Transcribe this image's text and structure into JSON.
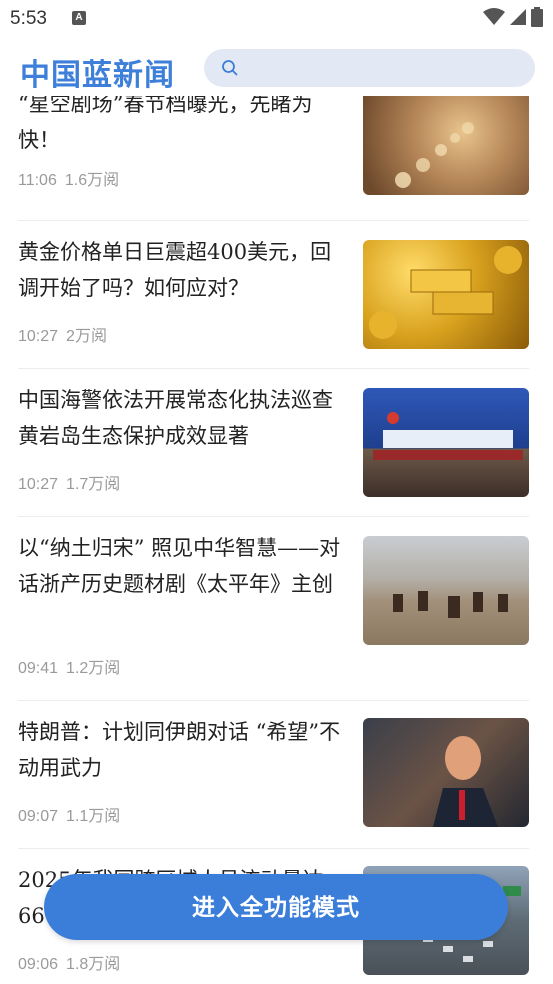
{
  "status_bar": {
    "time": "5:53",
    "indicator": "A"
  },
  "header": {
    "logo": "中国蓝新闻",
    "search_placeholder": ""
  },
  "articles": [
    {
      "title": "“星空剧场”春节档曝光，先睹为快！",
      "time": "11:06",
      "views": "1.6万阅",
      "image": "golden-bokeh-moon-phases"
    },
    {
      "title": "黄金价格单日巨震超400美元，回调开始了吗？如何应对？",
      "time": "10:27",
      "views": "2万阅",
      "image": "gold-bars-and-coins"
    },
    {
      "title": "中国海警依法开展常态化执法巡查 黄岩岛生态保护成效显著",
      "time": "10:27",
      "views": "1.7万阅",
      "image": "china-coast-guard-press-conference"
    },
    {
      "title": "以“纳土归宋” 照见中华智慧——对话浙产历史题材剧《太平年》主创",
      "time": "09:41",
      "views": "1.2万阅",
      "image": "cavalry-in-desert"
    },
    {
      "title": "特朗普：计划同伊朗对话 “希望”不动用武力",
      "time": "09:07",
      "views": "1.1万阅",
      "image": "trump-speaking"
    },
    {
      "title": "2025年我国跨区域人员流动量达66",
      "time": "09:06",
      "views": "1.8万阅",
      "image": "highway-traffic"
    }
  ],
  "bottom_button": {
    "label": "进入全功能模式"
  }
}
